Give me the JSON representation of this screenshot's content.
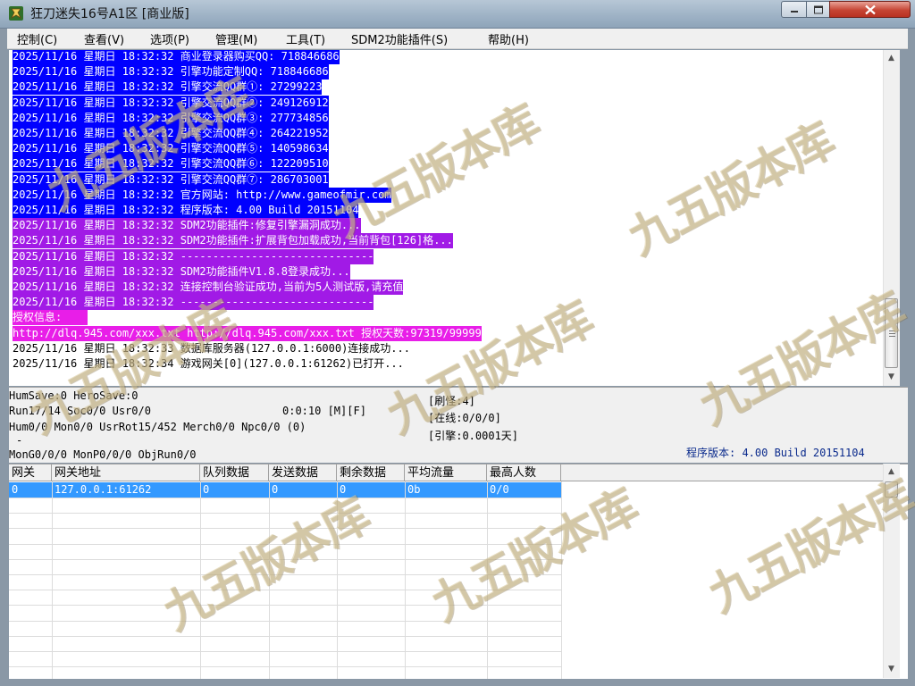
{
  "window": {
    "title": "狂刀迷失16号A1区 [商业版]",
    "controls": [
      "minimize",
      "maximize",
      "close"
    ]
  },
  "menu": [
    {
      "label": "控制(C)"
    },
    {
      "label": "查看(V)"
    },
    {
      "label": "选项(P)"
    },
    {
      "label": "管理(M)"
    },
    {
      "label": "工具(T)"
    },
    {
      "label": "SDM2功能插件(S)"
    },
    {
      "label": "帮助(H)"
    }
  ],
  "colors": {
    "blue_highlight": "#0000ff",
    "purple_highlight": "#a11ae6",
    "magenta_highlight": "#e81ee8",
    "selection": "#3399ff",
    "version_text": "#0a2a8c"
  },
  "log": [
    {
      "text": "2025/11/16 星期日 18:32:32 商业登录器购买QQ: 718846686",
      "style": "blue"
    },
    {
      "text": "2025/11/16 星期日 18:32:32 引擎功能定制QQ: 718846686",
      "style": "blue"
    },
    {
      "text": "2025/11/16 星期日 18:32:32 引擎交流QQ群①: 27299223",
      "style": "blue"
    },
    {
      "text": "2025/11/16 星期日 18:32:32 引擎交流QQ群②: 249126912",
      "style": "blue"
    },
    {
      "text": "2025/11/16 星期日 18:32:32 引擎交流QQ群③: 277734856",
      "style": "blue"
    },
    {
      "text": "2025/11/16 星期日 18:32:32 引擎交流QQ群④: 264221952",
      "style": "blue"
    },
    {
      "text": "2025/11/16 星期日 18:32:32 引擎交流QQ群⑤: 140598634",
      "style": "blue"
    },
    {
      "text": "2025/11/16 星期日 18:32:32 引擎交流QQ群⑥: 122209510",
      "style": "blue"
    },
    {
      "text": "2025/11/16 星期日 18:32:32 引擎交流QQ群⑦: 286703001",
      "style": "blue"
    },
    {
      "text": "2025/11/16 星期日 18:32:32 官方网站: http://www.gameofmir.com",
      "style": "blue"
    },
    {
      "text": "2025/11/16 星期日 18:32:32 程序版本: 4.00 Build 20151104",
      "style": "blue"
    },
    {
      "text": "2025/11/16 星期日 18:32:32 SDM2功能插件:修复引擎漏洞成功...",
      "style": "purple"
    },
    {
      "text": "2025/11/16 星期日 18:32:32 SDM2功能插件:扩展背包加载成功,当前背包[126]格...",
      "style": "purple"
    },
    {
      "text": "2025/11/16 星期日 18:32:32 ------------------------------",
      "style": "purple"
    },
    {
      "text": "2025/11/16 星期日 18:32:32 SDM2功能插件V1.8.8登录成功...",
      "style": "purple"
    },
    {
      "text": "2025/11/16 星期日 18:32:32 连接控制台验证成功,当前为5人测试版,请充值",
      "style": "purple"
    },
    {
      "text": "2025/11/16 星期日 18:32:32 ------------------------------",
      "style": "purple"
    },
    {
      "text": "授权信息:",
      "style": "magenta"
    },
    {
      "text": "http://dlq.945.com/xxx.txt http://dlq.945.com/xxx.txt 授权天数:97319/99999",
      "style": "magenta"
    },
    {
      "text": "2025/11/16 星期日 18:32:33 数据库服务器(127.0.0.1:6000)连接成功...",
      "style": "plain"
    },
    {
      "text": "2025/11/16 星期日 18:32:34 游戏网关[0](127.0.0.1:61262)已打开...",
      "style": "plain"
    }
  ],
  "status": {
    "line1": "HumSave:0 HeroSave:0",
    "line2": "Run17/14 Soc0/0 Usr0/0",
    "time": "0:0:10 [M][F]",
    "line3": "Hum0/0 Mon0/0 UsrRot15/452 Merch0/0 Npc0/0 (0)",
    "line4": "-",
    "line5": "MonG0/0/0 MonP0/0/0 ObjRun0/0",
    "refresh": "[刷怪:4]",
    "online": "[在线:0/0/0]",
    "engine": "[引擎:0.0001天]",
    "version": "程序版本: 4.00 Build 20151104"
  },
  "table": {
    "columns": [
      "网关",
      "网关地址",
      "队列数据",
      "发送数据",
      "剩余数据",
      "平均流量",
      "最高人数"
    ],
    "rows": [
      [
        "0",
        "127.0.0.1:61262",
        "0",
        "0",
        "0",
        "0b",
        "0/0"
      ]
    ]
  },
  "watermark": {
    "text": "九五版本库",
    "url": "www.95bbb.com"
  }
}
